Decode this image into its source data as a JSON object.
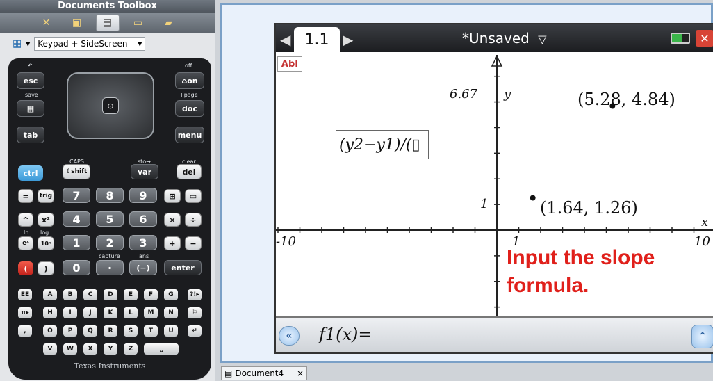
{
  "toolbox": {
    "title": "Documents Toolbox",
    "tabs": [
      "tools-icon",
      "library-icon",
      "calculator-icon",
      "book-icon",
      "folder-icon"
    ],
    "keypad_select": "Keypad + SideScreen",
    "select_arrow": "▾",
    "calculator_icon": "▦"
  },
  "handheld": {
    "keys": {
      "esc": "esc",
      "on": "on",
      "doc": "doc",
      "menu": "menu",
      "tab": "tab",
      "ctrl": "ctrl",
      "shift": "⇧shift",
      "var": "var",
      "del": "del",
      "eq": "=",
      "trig": "trig",
      "seven": "7",
      "eight": "8",
      "nine": "9",
      "caret": "^",
      "x2": "x²",
      "four": "4",
      "five": "5",
      "six": "6",
      "times": "×",
      "divide": "÷",
      "ex": "eˣ",
      "tenx": "10ˣ",
      "one": "1",
      "two": "2",
      "three": "3",
      "plus": "+",
      "minus": "−",
      "lparen": "(",
      "rparen": ")",
      "zero": "0",
      "dot": "·",
      "neg": "(−)",
      "enter": "enter",
      "ee": "EE",
      "pi": "π▸",
      "comma": ",",
      "question": "?!▸",
      "flag": "⚐",
      "return": "↵"
    },
    "labels": {
      "undo": "↶",
      "save": "save",
      "off": "off",
      "page": "+page",
      "caps": "CAPS",
      "sto": "sto→",
      "clear": "clear",
      "capture": "capture",
      "ans": "ans",
      "ln": "ln",
      "log": "log"
    },
    "alpha_rows": [
      [
        "A",
        "B",
        "C",
        "D",
        "E",
        "F",
        "G"
      ],
      [
        "H",
        "I",
        "J",
        "K",
        "L",
        "M",
        "N"
      ],
      [
        "O",
        "P",
        "Q",
        "R",
        "S",
        "T",
        "U"
      ],
      [
        "V",
        "W",
        "X",
        "Y",
        "Z"
      ]
    ],
    "logo": "Texas Instruments"
  },
  "screen": {
    "page_tab": "1.1",
    "doc_title": "*Unsaved",
    "doc_menu": "▽",
    "text_tool": "AbI",
    "formula_input": "(y2−y1)/(▯",
    "entry_label": "f1(x)=",
    "history_glyph": "«",
    "expand_glyph": "⌃"
  },
  "graph": {
    "y_max_label": "6.67",
    "y_axis_label": "y",
    "x_axis_label": "x",
    "x_min_label": "-10",
    "x_max_label": "10",
    "x_one_label": "1",
    "y_one_label": "1",
    "points": [
      {
        "x": 5.28,
        "y": 4.84,
        "label": "(5.28, 4.84)"
      },
      {
        "x": 1.64,
        "y": 1.26,
        "label": "(1.64, 1.26)"
      }
    ],
    "x_range": [
      -10,
      10
    ],
    "y_range": [
      -4.64,
      6.67
    ]
  },
  "annotation": "Input the slope formula.",
  "doc_tab": {
    "name": "Document4",
    "close": "×"
  }
}
